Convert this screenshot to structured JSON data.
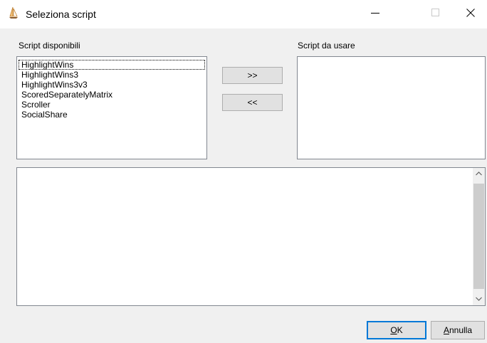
{
  "window": {
    "title": "Seleziona script",
    "controls": [
      "minimize",
      "maximize",
      "close"
    ]
  },
  "available": {
    "label": "Script disponibili",
    "items": [
      "HighlightWins",
      "HighlightWins3",
      "HighlightWins3v3",
      "ScoredSeparatelyMatrix",
      "Scroller",
      "SocialShare"
    ],
    "focused_index": 0
  },
  "selected": {
    "label": "Script da usare",
    "items": []
  },
  "buttons": {
    "add": ">>",
    "remove": "<<",
    "ok_mnemonic": "O",
    "ok_rest": "K",
    "cancel_mnemonic": "A",
    "cancel_rest": "nnulla"
  },
  "description": {
    "text": ""
  },
  "colors": {
    "default_button_border": "#0078d7",
    "window_background": "#f0f0f0"
  }
}
